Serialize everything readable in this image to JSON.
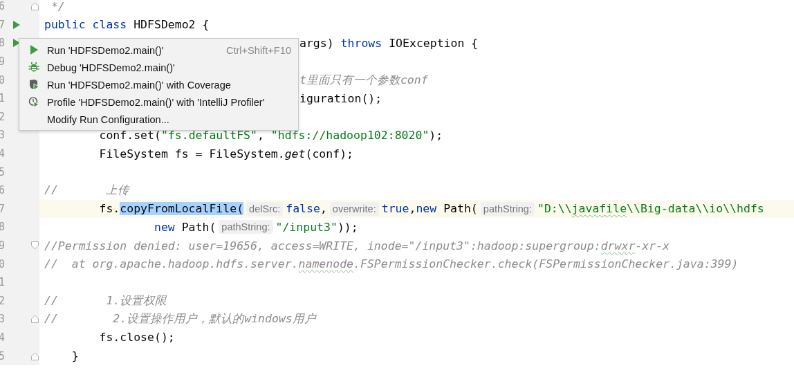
{
  "editor": {
    "lines": [
      {
        "number": "6",
        "fold_end": true,
        "tokens": [
          {
            "kind": "comment",
            "text": " */"
          }
        ]
      },
      {
        "number": "7",
        "run": true,
        "tokens": [
          {
            "kind": "keyword",
            "text": "public"
          },
          {
            "kind": "keyword",
            "text": " class"
          },
          {
            "kind": "plain",
            "text": " HDFSDemo2 {"
          }
        ]
      },
      {
        "number": "8",
        "run": true,
        "partial": true,
        "tokens": [
          {
            "kind": "plain",
            "text": "args)"
          },
          {
            "kind": "keyword",
            "text": " throws"
          },
          {
            "kind": "plain",
            "text": " IOException {"
          }
        ]
      },
      {
        "number": "9"
      },
      {
        "number": "0",
        "partial": true,
        "tokens": [
          {
            "kind": "comment",
            "text": "t里面只有一个参数conf"
          }
        ]
      },
      {
        "number": "1",
        "partial": true,
        "tokens": [
          {
            "kind": "plain",
            "text": "iguration();"
          }
        ]
      },
      {
        "number": "2"
      },
      {
        "number": "3",
        "tokens": [
          {
            "kind": "plain",
            "text": "        conf.set("
          },
          {
            "kind": "string",
            "text": "\"fs.defaultFS\""
          },
          {
            "kind": "plain",
            "text": ", "
          },
          {
            "kind": "string",
            "text": "\"hdfs://hadoop102:8020\""
          },
          {
            "kind": "plain",
            "text": ");"
          }
        ]
      },
      {
        "number": "4",
        "tokens": [
          {
            "kind": "plain",
            "text": "        FileSystem fs = FileSystem."
          },
          {
            "kind": "italic",
            "text": "get"
          },
          {
            "kind": "plain",
            "text": "(conf);"
          }
        ]
      },
      {
        "number": "5"
      },
      {
        "number": "6",
        "tokens": [
          {
            "kind": "comment",
            "text": "//       上传"
          }
        ]
      },
      {
        "number": "7",
        "current": true,
        "tokens": [
          {
            "kind": "plain",
            "text": "        fs."
          },
          {
            "kind": "selected",
            "text": "copyFromLocalFile("
          },
          {
            "kind": "hint",
            "text": "delSrc:"
          },
          {
            "kind": "keyword",
            "text": "false"
          },
          {
            "kind": "plain",
            "text": ","
          },
          {
            "kind": "hint",
            "text": "overwrite:"
          },
          {
            "kind": "keyword",
            "text": "true"
          },
          {
            "kind": "plain",
            "text": ","
          },
          {
            "kind": "keyword",
            "text": "new"
          },
          {
            "kind": "plain",
            "text": " Path("
          },
          {
            "kind": "hint",
            "text": "pathString:"
          },
          {
            "kind": "string",
            "text": "\"D:\\\\"
          },
          {
            "kind": "string",
            "text": "javafile",
            "typo": true
          },
          {
            "kind": "string",
            "text": "\\\\Big-data\\\\io\\\\hdfs"
          }
        ]
      },
      {
        "number": "8",
        "tokens": [
          {
            "kind": "keyword",
            "text": "                new"
          },
          {
            "kind": "plain",
            "text": " Path("
          },
          {
            "kind": "hint",
            "text": "pathString:"
          },
          {
            "kind": "string",
            "text": "\"/input3\""
          },
          {
            "kind": "plain",
            "text": "));"
          }
        ]
      },
      {
        "number": "9",
        "fold_start": true,
        "tokens": [
          {
            "kind": "comment",
            "text": "//Permission denied: user=19656, access=WRITE, inode=\"/input3\":hadoop:supergroup:"
          },
          {
            "kind": "comment",
            "text": "drwxr",
            "typo": true
          },
          {
            "kind": "comment",
            "text": "-xr-x"
          }
        ]
      },
      {
        "number": "0",
        "tokens": [
          {
            "kind": "comment",
            "text": "//  at org.apache.hadoop.hdfs.server."
          },
          {
            "kind": "comment",
            "text": "namenode",
            "typo": true
          },
          {
            "kind": "comment",
            "text": ".FSPermissionChecker.check(FSPermissionChecker.java:399)"
          }
        ]
      },
      {
        "number": "1"
      },
      {
        "number": "2",
        "tokens": [
          {
            "kind": "comment",
            "text": "//       1.设置权限"
          }
        ]
      },
      {
        "number": "3",
        "fold_end": true,
        "tokens": [
          {
            "kind": "comment",
            "text": "//        2.设置操作用户，默认的windows用户"
          }
        ]
      },
      {
        "number": "4",
        "tokens": [
          {
            "kind": "plain",
            "text": "        fs.close();"
          }
        ]
      },
      {
        "number": "5",
        "fold_end": true,
        "tokens": [
          {
            "kind": "plain",
            "text": "    }"
          }
        ]
      }
    ]
  },
  "popup_menu": {
    "items": [
      {
        "kind": "run",
        "label": "Run 'HDFSDemo2.main()'",
        "shortcut": "Ctrl+Shift+F10"
      },
      {
        "kind": "debug",
        "label": "Debug 'HDFSDemo2.main()'"
      },
      {
        "kind": "coverage",
        "label": "Run 'HDFSDemo2.main()' with Coverage"
      },
      {
        "kind": "profile",
        "label": "Profile 'HDFSDemo2.main()' with 'IntelliJ Profiler'"
      },
      {
        "kind": "plain",
        "label": "Modify Run Configuration..."
      }
    ]
  }
}
